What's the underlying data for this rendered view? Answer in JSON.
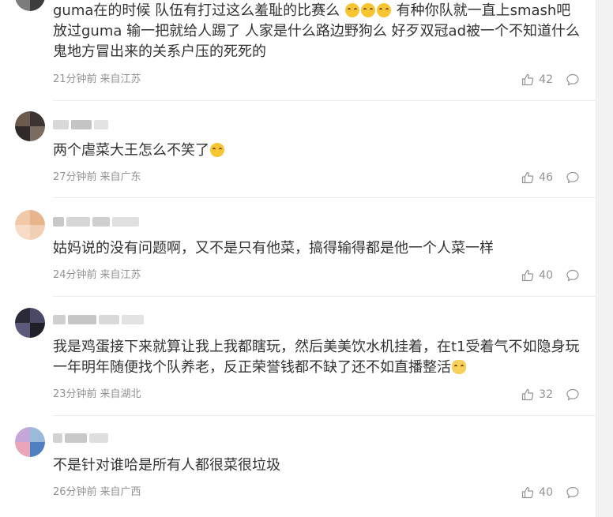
{
  "comments": [
    {
      "text_before": "guma在的时候 队伍有打过这么羞耻的比赛么 ",
      "emoji": [
        "laugh-cry-emoji",
        "laugh-cry-emoji",
        "laugh-cry-emoji"
      ],
      "text_after": " 有种你队就一直上smash吧 放过guma 输一把就给人踢了 人家是什么路边野狗么 好歹双冠ad被一个不知道什么鬼地方冒出来的关系户压的死死的",
      "time": "21分钟前",
      "location": "来自江苏",
      "likes": "42"
    },
    {
      "text_before": "两个虐菜大王怎么不笑了",
      "emoji": [
        "smile-emoji"
      ],
      "text_after": "",
      "time": "27分钟前",
      "location": "来自广东",
      "likes": "46"
    },
    {
      "text_before": "姑妈说的没有问题啊，又不是只有他菜，搞得输得都是他一个人菜一样",
      "emoji": [],
      "text_after": "",
      "time": "24分钟前",
      "location": "来自江苏",
      "likes": "40"
    },
    {
      "text_before": "我是鸡蛋接下来就算让我上我都瞎玩，然后美美饮水机挂着，在t1受着气不如隐身玩一年明年随便找个队养老，反正荣誉钱都不缺了还不如直播整活",
      "emoji": [
        "cat-emoji"
      ],
      "text_after": "",
      "time": "23分钟前",
      "location": "来自湖北",
      "likes": "32"
    },
    {
      "text_before": "不是针对谁哈是所有人都很菜很垃圾",
      "emoji": [],
      "text_after": "",
      "time": "26分钟前",
      "location": "来自广西",
      "likes": "40"
    }
  ],
  "colors": {
    "text": "#333333",
    "meta": "#939393",
    "divider": "#ececec",
    "background": "#ffffff"
  },
  "icons": {
    "like": "thumbs-up-icon",
    "reply": "speech-bubble-icon"
  }
}
